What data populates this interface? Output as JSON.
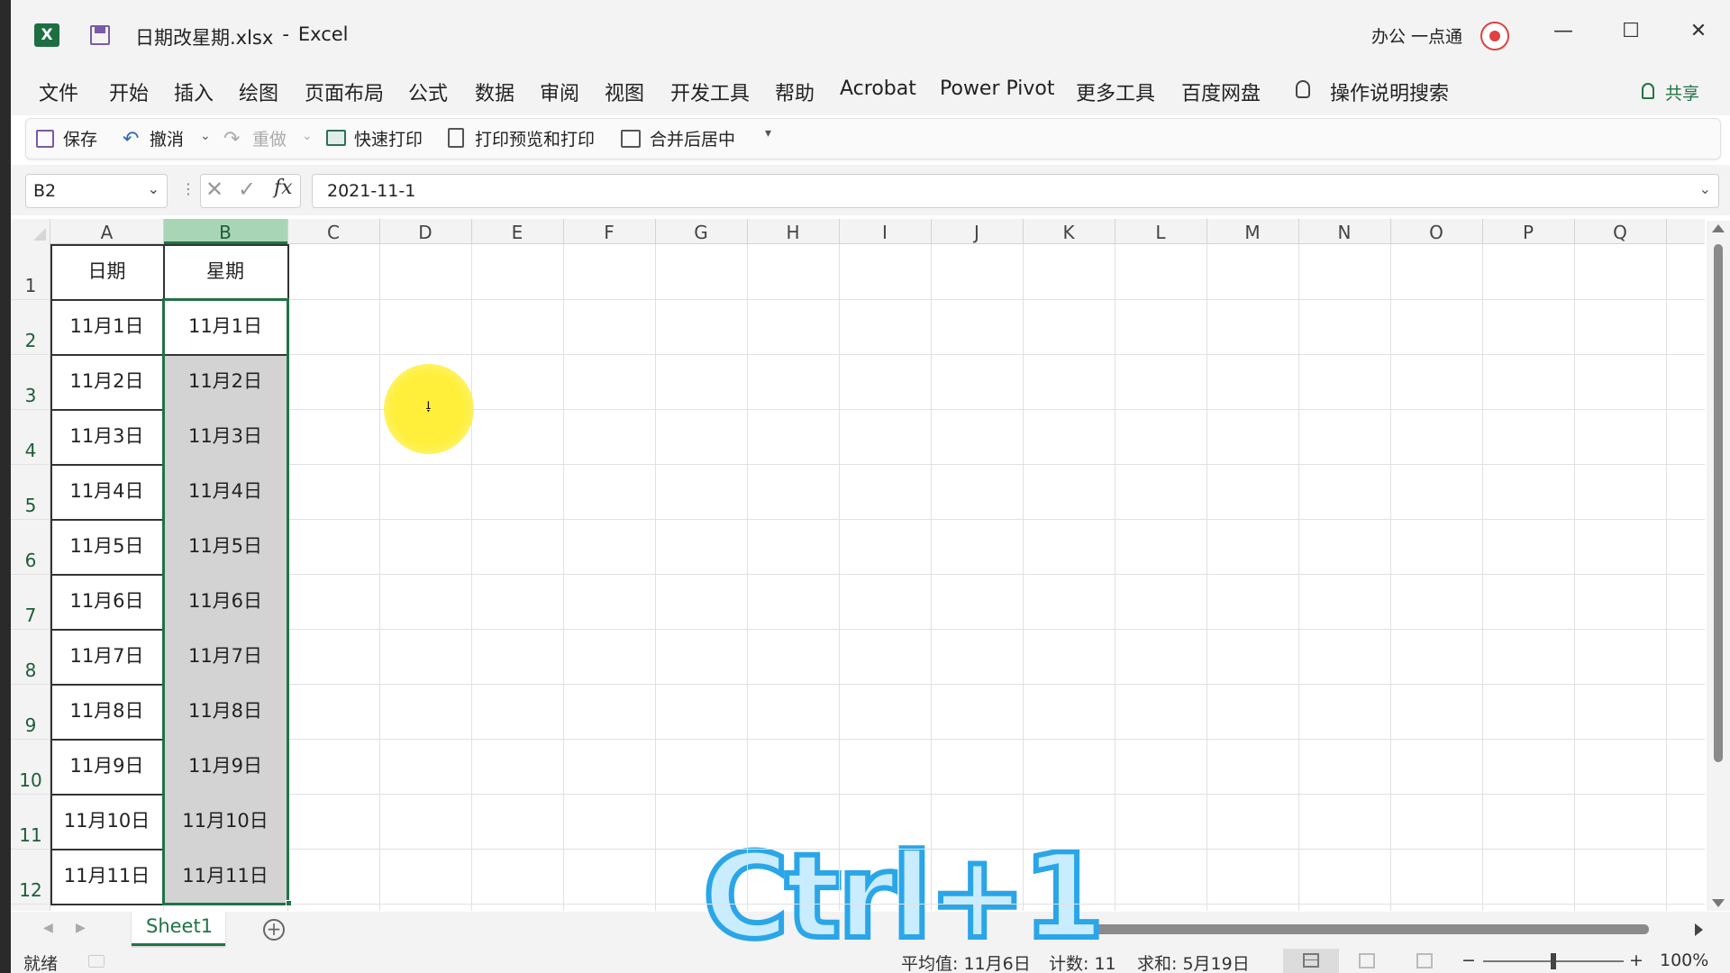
{
  "window": {
    "filename": "日期改星期.xlsx",
    "separator": "-",
    "app": "Excel",
    "user": "办公 一点通",
    "min_label": "—",
    "max_label": "☐",
    "close_label": "✕"
  },
  "menu": {
    "items": [
      "文件",
      "开始",
      "插入",
      "绘图",
      "页面布局",
      "公式",
      "数据",
      "审阅",
      "视图",
      "开发工具",
      "帮助",
      "Acrobat",
      "Power Pivot",
      "更多工具",
      "百度网盘"
    ],
    "search_label": "操作说明搜索",
    "share_label": "共享"
  },
  "qat": {
    "save": "保存",
    "undo": "撤消",
    "redo": "重做",
    "quick_print": "快速打印",
    "print_preview": "打印预览和打印",
    "merge_center": "合并后居中"
  },
  "formula_bar": {
    "name_box": "B2",
    "fx": "fx",
    "value": "2021-11-1"
  },
  "grid": {
    "columns": [
      "A",
      "B",
      "C",
      "D",
      "E",
      "F",
      "G",
      "H",
      "I",
      "J",
      "K",
      "L",
      "M",
      "N",
      "O",
      "P",
      "Q"
    ],
    "rows": [
      "1",
      "2",
      "3",
      "4",
      "5",
      "6",
      "7",
      "8",
      "9",
      "10",
      "11",
      "12"
    ],
    "header_row": [
      "日期",
      "星期"
    ],
    "col_a": [
      "11月1日",
      "11月2日",
      "11月3日",
      "11月4日",
      "11月5日",
      "11月6日",
      "11月7日",
      "11月8日",
      "11月9日",
      "11月10日",
      "11月11日"
    ],
    "col_b": [
      "11月1日",
      "11月2日",
      "11月3日",
      "11月4日",
      "11月5日",
      "11月6日",
      "11月7日",
      "11月8日",
      "11月9日",
      "11月10日",
      "11月11日"
    ],
    "selected_range": "B2:B12"
  },
  "sheets": {
    "tabs": [
      "Sheet1"
    ],
    "active": "Sheet1"
  },
  "status": {
    "mode": "就绪",
    "average": "平均值: 11月6日",
    "count": "计数: 11",
    "sum": "求和: 5月19日",
    "zoom": "100%",
    "zoom_minus": "−",
    "zoom_plus": "+"
  },
  "overlay": {
    "shortcut_caption": "Ctrl+1"
  },
  "colors": {
    "accent_green": "#217346",
    "selection_fill": "#d3d3d3",
    "header_selected": "#a9d5b7"
  }
}
